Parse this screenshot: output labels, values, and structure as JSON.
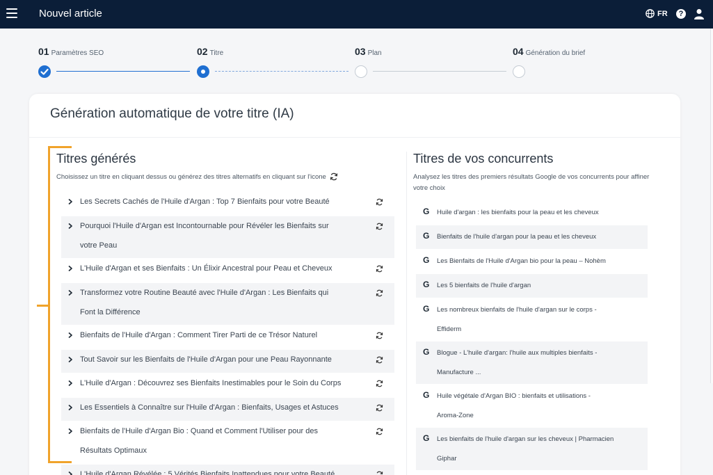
{
  "header": {
    "title": "Nouvel article",
    "language": "FR",
    "help": "?"
  },
  "stepper": {
    "steps": [
      {
        "number": "01",
        "name": "Paramètres SEO",
        "status": "done"
      },
      {
        "number": "02",
        "name": "Titre",
        "status": "active"
      },
      {
        "number": "03",
        "name": "Plan",
        "status": "todo"
      },
      {
        "number": "04",
        "name": "Génération du brief",
        "status": "todo"
      }
    ]
  },
  "card": {
    "title": "Génération automatique de votre titre (IA)"
  },
  "generated": {
    "title": "Titres générés",
    "subtitle": "Choisissez un titre en cliquant dessus ou générez des titres alternatifs en cliquant sur l'icone",
    "items": [
      {
        "line1": "Les Secrets Cachés de l'Huile d'Argan : Top 7 Bienfaits pour votre Beauté",
        "line2": ""
      },
      {
        "line1": "Pourquoi l'Huile d'Argan est Incontournable pour Révéler les Bienfaits sur",
        "line2": "votre Peau"
      },
      {
        "line1": "L'Huile d'Argan et ses Bienfaits : Un Élixir Ancestral pour Peau et Cheveux",
        "line2": ""
      },
      {
        "line1": "Transformez votre Routine Beauté avec l'Huile d'Argan : Les Bienfaits qui",
        "line2": "Font la Différence"
      },
      {
        "line1": "Bienfaits de l'Huile d'Argan : Comment Tirer Parti de ce Trésor Naturel",
        "line2": ""
      },
      {
        "line1": "Tout Savoir sur les Bienfaits de l'Huile d'Argan pour une Peau Rayonnante",
        "line2": ""
      },
      {
        "line1": "L'Huile d'Argan : Découvrez ses Bienfaits Inestimables pour le Soin du Corps",
        "line2": ""
      },
      {
        "line1": "Les Essentiels à Connaître sur l'Huile d'Argan : Bienfaits, Usages et Astuces",
        "line2": ""
      },
      {
        "line1": "Bienfaits de l'Huile d'Argan Bio : Quand et Comment l'Utiliser pour des",
        "line2": "Résultats Optimaux"
      },
      {
        "line1": "L'Huile d'Argan Révélée : 5 Vérités Bienfaits Inattendues pour votre Beauté",
        "line2": ""
      }
    ]
  },
  "competitors": {
    "title": "Titres de vos concurrents",
    "subtitle": "Analysez les titres des premiers résultats Google de vos concurrents pour affiner votre choix",
    "source_letter": "G",
    "items": [
      {
        "line1": "Huile d'argan : les bienfaits pour la peau et les cheveux",
        "line2": ""
      },
      {
        "line1": "Bienfaits de l'huile d'argan pour la peau et les cheveux",
        "line2": ""
      },
      {
        "line1": "Les Bienfaits de l'Huile d'Argan bio pour la peau – Nohèm",
        "line2": ""
      },
      {
        "line1": "Les 5 bienfaits de l'huile d'argan",
        "line2": ""
      },
      {
        "line1": "Les nombreux bienfaits de l'huile d'argan sur le corps -",
        "line2": "Effiderm"
      },
      {
        "line1": "Blogue - L'huile d'argan: l'huile aux multiples bienfaits -",
        "line2": "Manufacture ..."
      },
      {
        "line1": "Huile végétale d'Argan BIO : bienfaits et utilisations -",
        "line2": "Aroma-Zone"
      },
      {
        "line1": "Les bienfaits de l'huile d'argan sur les cheveux | Pharmacien",
        "line2": "Giphar"
      }
    ]
  },
  "colors": {
    "topbar": "#0b1e38",
    "accent": "#1f6fd1",
    "bracket": "#f0a32b"
  },
  "icons": {
    "menu": "hamburger-icon",
    "lang": "globe-icon",
    "help": "question-icon",
    "user": "user-icon",
    "refresh": "refresh-icon",
    "chevron": "chevron-right-icon"
  }
}
